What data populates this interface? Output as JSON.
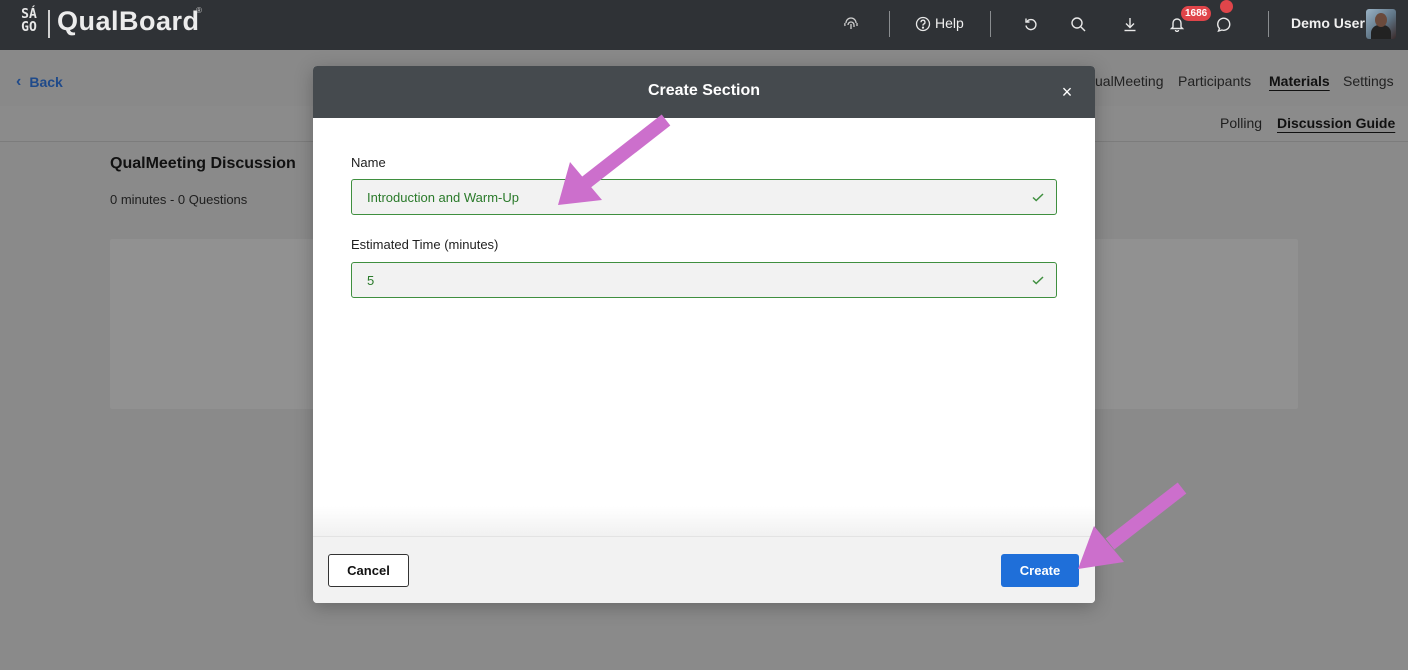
{
  "app": {
    "logo_top": "SÁ",
    "logo_bottom": "GO",
    "name": "QualBoard",
    "registered_mark": "®"
  },
  "topbar": {
    "help_label": "Help",
    "notification_count": "1686",
    "user_name": "Demo User",
    "icons": [
      "fingerprint-icon",
      "help-circle-icon",
      "undo-icon",
      "search-icon",
      "download-icon",
      "bell-icon",
      "chat-icon",
      "avatar"
    ]
  },
  "nav": {
    "back_label": "Back",
    "tabs": [
      {
        "label": "ualMeeting",
        "active": false
      },
      {
        "label": "Participants",
        "active": false
      },
      {
        "label": "Materials",
        "active": true
      },
      {
        "label": "Settings",
        "active": false
      }
    ],
    "subtabs": [
      {
        "label": "Polling",
        "active": false
      },
      {
        "label": "Discussion Guide",
        "active": true
      }
    ]
  },
  "page": {
    "title": "QualMeeting Discussion",
    "meta": "0 minutes - 0 Questions"
  },
  "modal": {
    "title": "Create Section",
    "close_symbol": "×",
    "name_label": "Name",
    "name_value": "Introduction and Warm-Up",
    "time_label": "Estimated Time (minutes)",
    "time_value": "5",
    "cancel_label": "Cancel",
    "create_label": "Create"
  },
  "colors": {
    "topbar": "#2f3236",
    "modal_header": "#454a4e",
    "valid_green": "#3f8f3f",
    "primary_button": "#1f6fd9",
    "badge_red": "#e0454a",
    "annotation_arrow": "#cc6fcc"
  }
}
